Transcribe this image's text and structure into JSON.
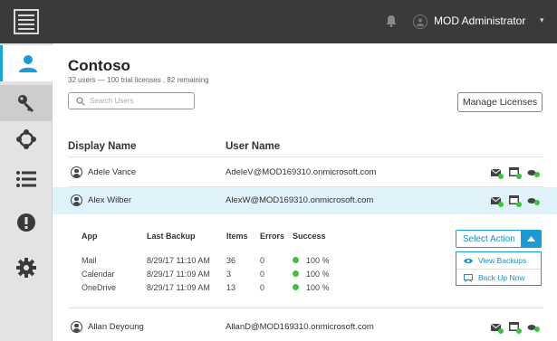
{
  "topbar": {
    "user_name": "MOD Administrator",
    "caret": "▾"
  },
  "sidebar": {
    "items": [
      {
        "name": "users",
        "icon": "user-icon",
        "active": true
      },
      {
        "name": "licenses",
        "icon": "key-icon"
      },
      {
        "name": "apps",
        "icon": "network-icon"
      },
      {
        "name": "list",
        "icon": "list-icon"
      },
      {
        "name": "alerts",
        "icon": "alert-icon"
      },
      {
        "name": "settings",
        "icon": "gear-icon"
      }
    ]
  },
  "header": {
    "tenant_name": "Contoso",
    "license_summary": "32 users — 100 trial licenses , 82 remaining",
    "search_placeholder": "Search Users",
    "manage_licenses_label": "Manage Licenses"
  },
  "table": {
    "columns": [
      "Display Name",
      "User Name"
    ],
    "rows": [
      {
        "display_name": "Adele Vance",
        "user_name": "AdeleV@MOD169310.onmicrosoft.com"
      },
      {
        "display_name": "Alex Wilber",
        "user_name": "AlexW@MOD169310.onmicrosoft.com",
        "selected": true
      },
      {
        "display_name": "Allan Deyoung",
        "user_name": "AllanD@MOD169310.onmicrosoft.com"
      }
    ]
  },
  "backup": {
    "columns": [
      "App",
      "Last Backup",
      "Items",
      "Errors",
      "Success"
    ],
    "rows": [
      {
        "app": "Mail",
        "last_backup": "8/29/17 11:10 AM",
        "items": "36",
        "errors": "0",
        "success": "100 %"
      },
      {
        "app": "Calendar",
        "last_backup": "8/29/17 11:09 AM",
        "items": "3",
        "errors": "0",
        "success": "100 %"
      },
      {
        "app": "OneDrive",
        "last_backup": "8/29/17 11:09 AM",
        "items": "13",
        "errors": "0",
        "success": "100 %"
      }
    ],
    "select_action_label": "Select Action",
    "menu": {
      "view_backups": "View Backups",
      "back_up_now": "Back Up Now"
    }
  },
  "colors": {
    "accent": "#1a9ad6",
    "topbar": "#3a3a3a",
    "sidebar": "#e3e3e3",
    "success": "#3ec23e",
    "selected_row": "#dff1f9"
  }
}
